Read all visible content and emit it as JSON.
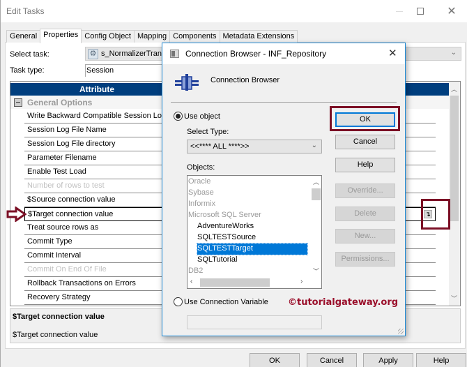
{
  "window": {
    "title": "Edit Tasks"
  },
  "tabs": [
    {
      "label": "General",
      "active": false
    },
    {
      "label": "Properties",
      "active": true
    },
    {
      "label": "Config Object",
      "active": false
    },
    {
      "label": "Mapping",
      "active": false
    },
    {
      "label": "Components",
      "active": false
    },
    {
      "label": "Metadata Extensions",
      "active": false
    }
  ],
  "form": {
    "select_task_label": "Select task:",
    "select_task_value": "s_NormalizerTran",
    "task_type_label": "Task type:",
    "task_type_value": "Session"
  },
  "grid": {
    "header": "Attribute",
    "group": "General Options",
    "rows": [
      {
        "name": "Write Backward Compatible Session Log",
        "disabled": false
      },
      {
        "name": "Session Log File Name",
        "disabled": false
      },
      {
        "name": "Session Log File directory",
        "disabled": false
      },
      {
        "name": "Parameter Filename",
        "disabled": false
      },
      {
        "name": "Enable Test Load",
        "disabled": false
      },
      {
        "name": "Number of rows to test",
        "disabled": true
      },
      {
        "name": "$Source connection value",
        "disabled": false
      },
      {
        "name": "$Target connection value",
        "disabled": false,
        "selected": true
      },
      {
        "name": "Treat source rows as",
        "disabled": false
      },
      {
        "name": "Commit Type",
        "disabled": false
      },
      {
        "name": "Commit Interval",
        "disabled": false
      },
      {
        "name": "Commit On End Of File",
        "disabled": true
      },
      {
        "name": "Rollback Transactions on Errors",
        "disabled": false
      },
      {
        "name": "Recovery Strategy",
        "disabled": false
      }
    ]
  },
  "description": {
    "title": "$Target connection value",
    "text": "$Target connection value"
  },
  "bottom_buttons": {
    "ok": "OK",
    "cancel": "Cancel",
    "apply": "Apply",
    "help": "Help"
  },
  "dialog": {
    "title": "Connection Browser - INF_Repository",
    "heading": "Connection Browser",
    "use_object_label": "Use object",
    "use_object_checked": true,
    "select_type_label": "Select Type:",
    "select_type_value": "<<**** ALL ****>>",
    "objects_label": "Objects:",
    "objects": [
      {
        "label": "Oracle",
        "kind": "group"
      },
      {
        "label": "Sybase",
        "kind": "group"
      },
      {
        "label": "Informix",
        "kind": "group"
      },
      {
        "label": "Microsoft SQL Server",
        "kind": "group"
      },
      {
        "label": "AdventureWorks",
        "kind": "child"
      },
      {
        "label": "SQLTESTSource",
        "kind": "child"
      },
      {
        "label": "SQLTESTTarget",
        "kind": "child",
        "selected": true
      },
      {
        "label": "SQLTutorial",
        "kind": "child"
      },
      {
        "label": "DB2",
        "kind": "group"
      }
    ],
    "use_conn_var_label": "Use Connection Variable",
    "use_conn_var_checked": false,
    "conn_var_value": "",
    "buttons": {
      "ok": "OK",
      "cancel": "Cancel",
      "help": "Help",
      "override": "Override...",
      "delete": "Delete",
      "new": "New...",
      "permissions": "Permissions..."
    }
  },
  "watermark": "©tutorialgateway.org",
  "annotation_color": "#7b0f25"
}
